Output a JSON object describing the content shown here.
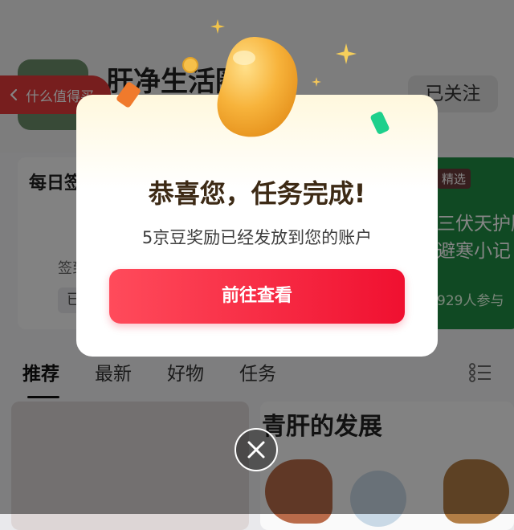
{
  "header": {
    "group_title": "肝净生活圈",
    "follow_label": "已关注",
    "back_label": "什么值得买"
  },
  "checkin_card": {
    "title": "每日签到",
    "sign_label": "签到",
    "badge": "已"
  },
  "featured_card": {
    "badge": "精选",
    "title": "三伏天护肝 避寒小记",
    "participants": "929人参与"
  },
  "tabs": [
    "推荐",
    "最新",
    "好物",
    "任务"
  ],
  "feed": {
    "right_title": "青肝的发展"
  },
  "modal": {
    "title": "恭喜您，任务完成!",
    "subtitle": "5京豆奖励已经发放到您的账户",
    "button_label": "前往查看"
  },
  "colors": {
    "brand_red": "#f01030",
    "overlay": "rgba(0,0,0,0.48)",
    "bean_gold": "#f5b238",
    "featured_green": "#1f8d43"
  },
  "icons": [
    "chevron-left-icon",
    "list-view-icon",
    "close-icon",
    "sparkle-icon",
    "coin-icon",
    "jd-bean-icon"
  ]
}
